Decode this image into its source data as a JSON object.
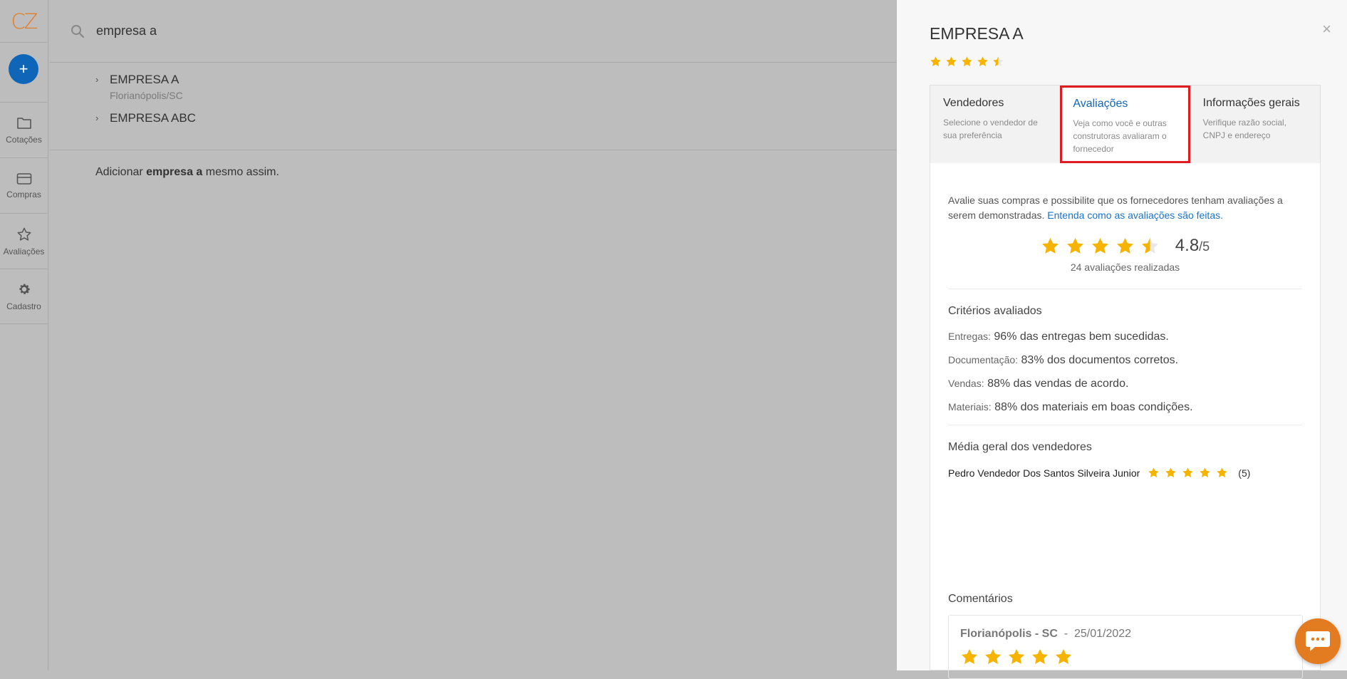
{
  "nav": {
    "logo": "CZ",
    "add_label": "+",
    "items": [
      {
        "label": "Cotações",
        "icon": "folder-icon"
      },
      {
        "label": "Compras",
        "icon": "card-icon"
      },
      {
        "label": "Avaliações",
        "icon": "star-icon"
      },
      {
        "label": "Cadastro",
        "icon": "gear-icon"
      }
    ]
  },
  "search": {
    "value": "empresa a",
    "placeholder": ""
  },
  "results": [
    {
      "name": "EMPRESA A",
      "location": "Florianópolis/SC"
    },
    {
      "name": "EMPRESA ABC",
      "location": ""
    }
  ],
  "add_line": {
    "prefix": "Adicionar ",
    "term": "empresa a",
    "suffix": " mesmo assim."
  },
  "drawer": {
    "title": "EMPRESA A",
    "close": "×",
    "header_rating": 4.5,
    "tabs": [
      {
        "title": "Vendedores",
        "desc": "Selecione o vendedor de sua preferência"
      },
      {
        "title": "Avaliações",
        "desc": "Veja como você e outras construtoras avaliaram o fornecedor"
      },
      {
        "title": "Informações gerais",
        "desc": "Verifique razão social, CNPJ e endereço"
      }
    ],
    "active_tab": 1,
    "intro_text": "Avalie suas compras e possibilite que os fornecedores tenham avaliações a serem demonstradas. ",
    "intro_link": "Entenda como as avaliações são feitas.",
    "rating": {
      "value": "4.8",
      "max": "/5",
      "stars": 4.5
    },
    "rating_count": "24 avaliações realizadas",
    "criteria_title": "Critérios avaliados",
    "criteria": [
      {
        "label": "Entregas:",
        "text": "96% das entregas bem sucedidas."
      },
      {
        "label": "Documentação:",
        "text": "83% dos documentos corretos."
      },
      {
        "label": "Vendas:",
        "text": "88% das vendas de acordo."
      },
      {
        "label": "Materiais:",
        "text": "88% dos materiais em boas condições."
      }
    ],
    "sellers_title": "Média geral dos vendedores",
    "sellers": [
      {
        "name": "Pedro Vendedor Dos Santos Silveira Junior",
        "stars": 5,
        "count": "(5)"
      }
    ],
    "comments_title": "Comentários",
    "comments": [
      {
        "location": "Florianópolis - SC",
        "sep": "-",
        "date": "25/01/2022",
        "stars": 5
      }
    ]
  },
  "colors": {
    "accent": "#0f66b9",
    "star": "#f6b400",
    "logo": "#e37b20",
    "highlight": "#e01b22"
  }
}
